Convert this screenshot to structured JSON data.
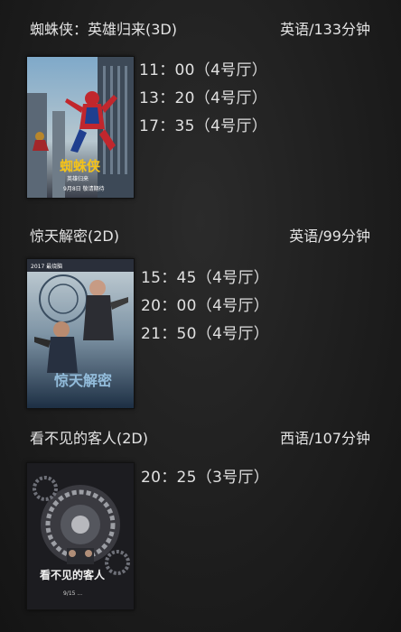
{
  "movies": [
    {
      "title": "蜘蛛侠：英雄归来(3D)",
      "lang_duration": "英语/133分钟",
      "showtimes": [
        "11：00（4号厅）",
        "13：20（4号厅）",
        "17：35（4号厅）"
      ],
      "poster_title": "蜘蛛侠",
      "poster_subtitle": "英雄归来",
      "poster_date": "9月8日 敬请期待"
    },
    {
      "title": "惊天解密(2D)",
      "lang_duration": "英语/99分钟",
      "showtimes": [
        "15：45（4号厅）",
        "20：00（4号厅）",
        "21：50（4号厅）"
      ],
      "poster_title": "惊天解密",
      "poster_badge": "2017 最烧脑"
    },
    {
      "title": "看不见的客人(2D)",
      "lang_duration": "西语/107分钟",
      "showtimes": [
        "20：25（3号厅）"
      ],
      "poster_title": "看不见的客人",
      "poster_date": "9/15 ..."
    }
  ],
  "colors": {
    "background": "#1e1e1e",
    "text": "#e0e0e0"
  }
}
